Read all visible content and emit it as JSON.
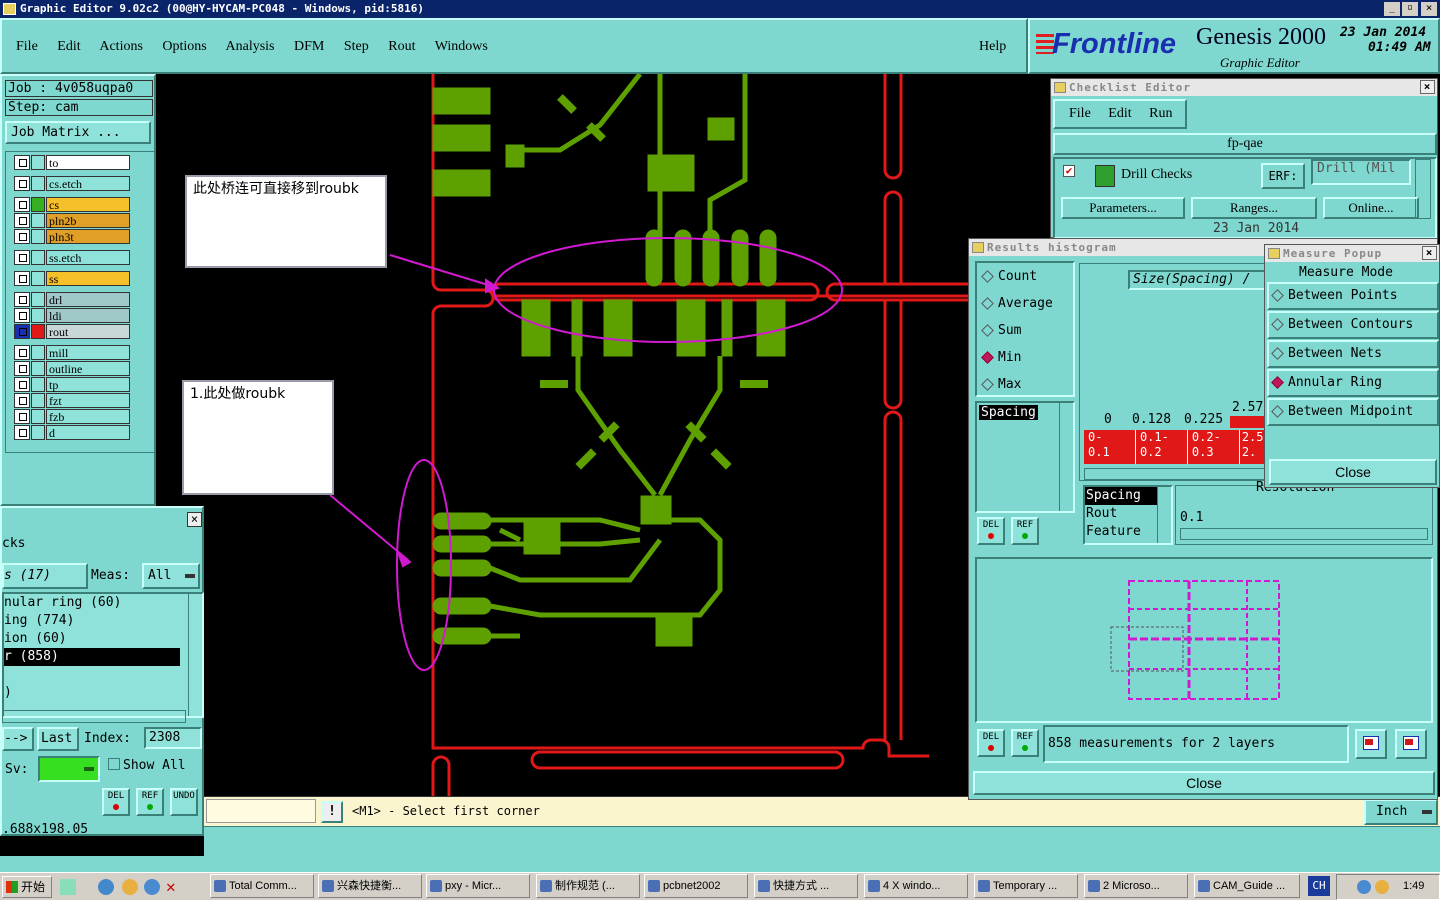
{
  "window": {
    "title": "Graphic Editor 9.02c2 (00@HY-HYCAM-PC048 - Windows, pid:5816)",
    "controls": [
      "_",
      "▫",
      "×"
    ]
  },
  "menu": {
    "items": [
      "File",
      "Edit",
      "Actions",
      "Options",
      "Analysis",
      "DFM",
      "Step",
      "Rout",
      "Windows"
    ],
    "help": "Help"
  },
  "brand": {
    "logo": "Frontline",
    "product": "Genesis 2000",
    "subtitle": "Graphic Editor",
    "date": "23 Jan 2014",
    "time": "01:49 AM"
  },
  "job": {
    "job": "Job : 4v058uqpa0",
    "step": "Step: cam",
    "matrix_btn": "Job Matrix ..."
  },
  "layers": [
    {
      "name": "to",
      "color": "#ffffff"
    },
    {
      "name": "cs.etch",
      "color": "#8fe2d9"
    },
    {
      "name": "cs",
      "color": "#f5c02a"
    },
    {
      "name": "pln2b",
      "color": "#e0a028"
    },
    {
      "name": "pln3t",
      "color": "#e0a028"
    },
    {
      "name": "ss.etch",
      "color": "#8fe2d9"
    },
    {
      "name": "ss",
      "color": "#f5c02a"
    },
    {
      "name": "drl",
      "color": "#a0c8c8"
    },
    {
      "name": "ldi",
      "color": "#a0c8c8"
    },
    {
      "name": "rout",
      "color": "#c8d8d8"
    },
    {
      "name": "mill",
      "color": "#8fe2d9"
    },
    {
      "name": "outline",
      "color": "#8fe2d9"
    },
    {
      "name": "tp",
      "color": "#8fe2d9"
    },
    {
      "name": "fzt",
      "color": "#8fe2d9"
    },
    {
      "name": "fzb",
      "color": "#8fe2d9"
    },
    {
      "name": "d",
      "color": "#8fe2d9"
    }
  ],
  "annotations": {
    "note1": "此处桥连可直接移到roubk",
    "note2": "1.此处做roubk"
  },
  "checks_panel": {
    "title": "cks",
    "count_label": "s (17)",
    "meas_label": "Meas:",
    "meas_value": "All",
    "items": [
      "nular ring (60)",
      "ing (774)",
      "ion (60)",
      "r (858)",
      "",
      ")"
    ],
    "next_btn": "-->",
    "last_btn": "Last",
    "index_label": "Index:",
    "index_value": "2308",
    "sv_label": "Sv:",
    "show_all": "Show All",
    "coords": ".688x198.05",
    "del": "DEL",
    "ref": "REF",
    "undo": "UNDO"
  },
  "status": {
    "prompt": "<M1> - Select first corner",
    "units": "Inch",
    "excl": "!"
  },
  "checklist_editor": {
    "title": "Checklist Editor",
    "menu": [
      "File",
      "Edit",
      "Run"
    ],
    "name": "fp-qae",
    "check_name": "Drill Checks",
    "erf_label": "ERF:",
    "erf_value": "Drill (Mil",
    "buttons": [
      "Parameters...",
      "Ranges...",
      "Online..."
    ],
    "date_row": "23 Jan 2014"
  },
  "results_histogram": {
    "title": "Results histogram",
    "modes": [
      {
        "label": "Count",
        "on": false
      },
      {
        "label": "Average",
        "on": false
      },
      {
        "label": "Sum",
        "on": false
      },
      {
        "label": "Min",
        "on": true
      },
      {
        "label": "Max",
        "on": false
      }
    ],
    "type_list": [
      "Spacing"
    ],
    "axis_label": "Size(Spacing) /",
    "axis_ticks": [
      "0",
      "0.128",
      "0.225",
      "2.57"
    ],
    "bins": [
      "0-\n0.1",
      "0.1-\n0.2",
      "0.2-\n0.3",
      "2.5\n2."
    ],
    "category_list": [
      "Spacing",
      "Rout",
      "Feature"
    ],
    "resolution_label": "Resolution",
    "resolution_value": "0.1",
    "summary": "858 measurements for 2 layers",
    "close": "Close",
    "del": "DEL",
    "ref": "REF"
  },
  "measure_popup": {
    "title": "Measure Popup",
    "header": "Measure Mode",
    "modes": [
      {
        "label": "Between Points",
        "on": false
      },
      {
        "label": "Between Contours",
        "on": false
      },
      {
        "label": "Between Nets",
        "on": false
      },
      {
        "label": "Annular Ring",
        "on": true
      },
      {
        "label": "Between Midpoint",
        "on": false
      }
    ],
    "close": "Close"
  },
  "taskbar": {
    "start": "开始",
    "tasks": [
      "Total Comm...",
      "兴森快捷衡...",
      "pxy - Micr...",
      "制作规范 (...",
      "pcbnet2002",
      "快捷方式 ...",
      "4 X windo...",
      "Temporary ...",
      "2 Microso...",
      "CAM_Guide ..."
    ],
    "lang": "CH",
    "clock": "1:49"
  },
  "colors": {
    "panel": "#7fd8cf",
    "copper": "#5ea000",
    "rout": "#e01818",
    "highlight": "#d01ad0",
    "checklist_red": "#e01818"
  }
}
